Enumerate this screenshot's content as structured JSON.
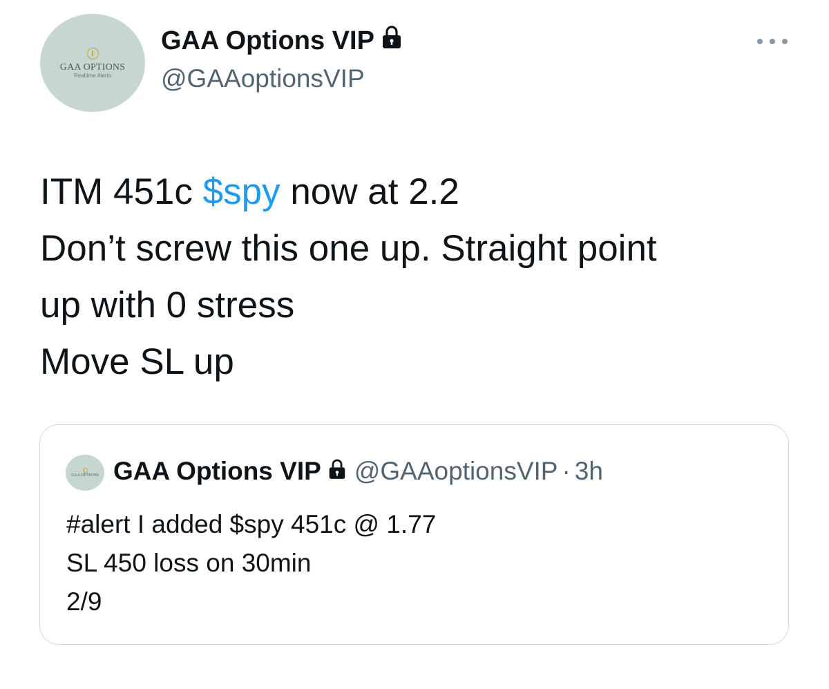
{
  "tweet": {
    "avatar": {
      "brand": "GAA OPTIONS",
      "subtitle": "Realtime Alerts"
    },
    "display_name": "GAA Options VIP",
    "handle": "@GAAoptionsVIP",
    "text": {
      "line1_prefix": "ITM 451c ",
      "line1_cashtag": "$spy",
      "line1_suffix": " now at 2.2",
      "line2": "Don’t screw this one up. Straight point",
      "line3": "up with 0 stress",
      "line4": "Move SL up"
    },
    "icons": {
      "lock": "lock-icon",
      "more": "more-horizontal-icon"
    }
  },
  "quoted_tweet": {
    "avatar": {
      "brand": "GAA OPTIONS"
    },
    "display_name": "GAA Options VIP",
    "handle": "@GAAoptionsVIP",
    "separator": "·",
    "time": "3h",
    "text": {
      "line1": "#alert I added $spy 451c @ 1.77",
      "line2": "SL 450 loss on 30min",
      "line3": "2/9"
    }
  },
  "colors": {
    "text": "#0f1419",
    "secondary": "#536471",
    "link": "#1d9bf0",
    "border": "#cfd9de",
    "avatar_bg": "#c6d6d1"
  }
}
